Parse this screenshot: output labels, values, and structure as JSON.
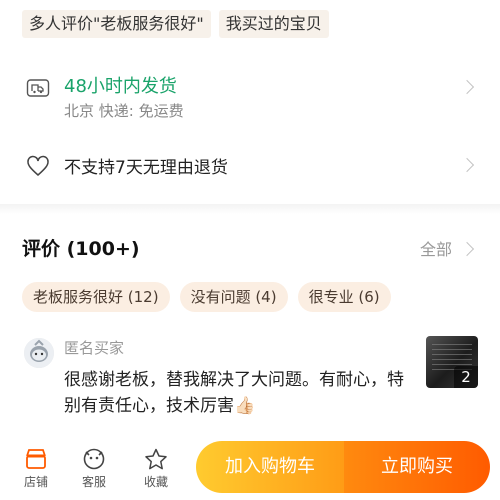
{
  "top_tags": [
    "多人评价\"老板服务很好\"",
    "我买过的宝贝"
  ],
  "shipping": {
    "title": "48小时内发货",
    "subtitle": "北京  快递: 免运费"
  },
  "returns": {
    "text": "不支持7天无理由退货"
  },
  "reviews": {
    "title": "评价 (100+)",
    "all_label": "全部",
    "chips": [
      "老板服务很好 (12)",
      "没有问题 (4)",
      "很专业 (6)"
    ],
    "item": {
      "reviewer": "匿名买家",
      "comment": "很感谢老板，替我解决了大问题。有耐心，特别有责任心，技术厉害👍🏻",
      "photo_count": "2"
    }
  },
  "bottom_nav": {
    "shop": "店铺",
    "service": "客服",
    "favorite": "收藏",
    "add_to_cart": "加入购物车",
    "buy_now": "立即购买"
  },
  "colors": {
    "shipping_green": "#1aa36a",
    "cart_gradient": [
      "#ffcb2f",
      "#ff9c16"
    ],
    "buy_gradient": [
      "#ff8a0f",
      "#ff5b00"
    ],
    "shop_icon": "#ff5b00"
  }
}
